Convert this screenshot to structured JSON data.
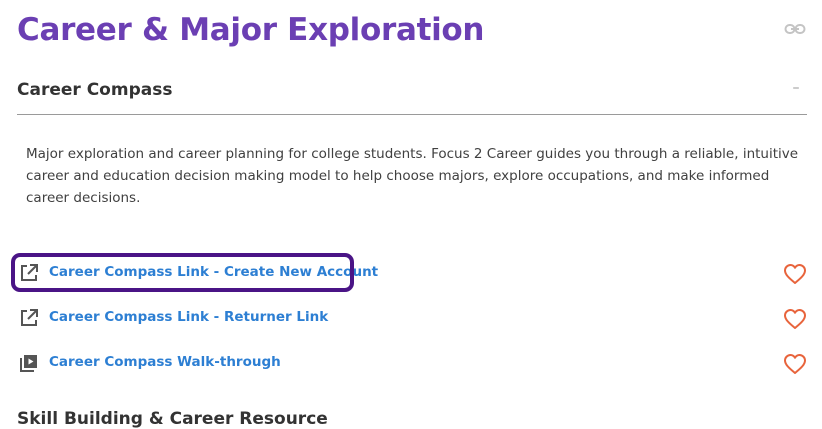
{
  "page": {
    "title": "Career & Major Exploration"
  },
  "section": {
    "title": "Career Compass",
    "collapse_symbol": "–",
    "description": "Major exploration and career planning for college students. Focus 2 Career guides you through a reliable, intuitive career and education decision making model to help choose majors, explore occupations, and make informed career decisions."
  },
  "resources": [
    {
      "label": "Career Compass Link - Create New Account",
      "icon": "external-link-icon",
      "favorite_icon": "heart-outline-icon",
      "focused": true
    },
    {
      "label": "Career Compass Link - Returner Link",
      "icon": "external-link-icon",
      "favorite_icon": "heart-outline-icon",
      "focused": false
    },
    {
      "label": "Career Compass Walk-through",
      "icon": "video-playlist-icon",
      "favorite_icon": "heart-outline-icon",
      "focused": false
    }
  ],
  "next_section": {
    "title": "Skill Building & Career Resource"
  },
  "colors": {
    "title": "#6b3fb3",
    "link": "#2d7fd3",
    "heart": "#e8643c",
    "focus_ring": "#4a1486"
  }
}
